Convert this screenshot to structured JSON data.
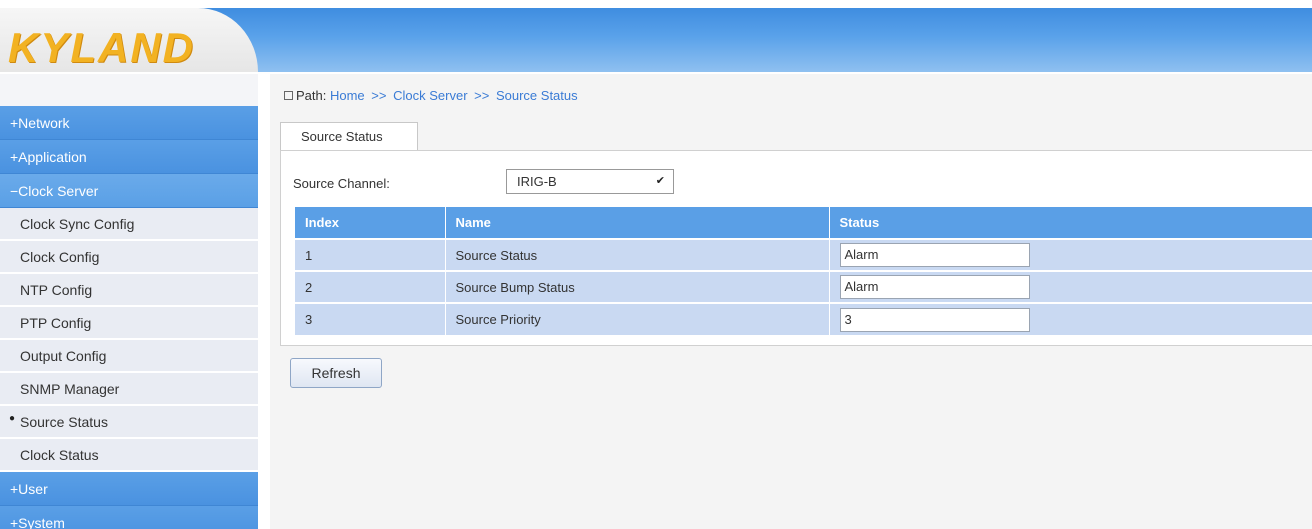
{
  "brand": {
    "logo_text": "KYLAND"
  },
  "sidebar": {
    "groups_top": [
      {
        "label": "+Network"
      },
      {
        "label": "+Application"
      },
      {
        "label": "−Clock Server"
      }
    ],
    "items": [
      {
        "label": "Clock Sync Config"
      },
      {
        "label": "Clock Config"
      },
      {
        "label": "NTP Config"
      },
      {
        "label": "PTP Config"
      },
      {
        "label": "Output Config"
      },
      {
        "label": "SNMP Manager"
      },
      {
        "label": "Source Status",
        "selected": true
      },
      {
        "label": "Clock Status"
      }
    ],
    "groups_bottom": [
      {
        "label": "+User"
      },
      {
        "label": "+System"
      }
    ]
  },
  "path": {
    "prefix": "Path:",
    "crumbs": [
      "Home",
      "Clock Server",
      "Source Status"
    ],
    "separator": ">>"
  },
  "tabs": [
    {
      "label": "Source Status"
    }
  ],
  "source_channel": {
    "label": "Source Channel:",
    "value": "IRIG-B"
  },
  "table": {
    "headers": [
      "Index",
      "Name",
      "Status"
    ],
    "rows": [
      {
        "index": "1",
        "name": "Source Status",
        "status": "Alarm"
      },
      {
        "index": "2",
        "name": "Source Bump Status",
        "status": "Alarm"
      },
      {
        "index": "3",
        "name": "Source Priority",
        "status": "3"
      }
    ]
  },
  "buttons": {
    "refresh": "Refresh"
  },
  "colors": {
    "nav_blue": "#4a92e0",
    "header_gradient_top": "#3f8de0",
    "logo_gold": "#f2b222",
    "row_bg": "#c9d9f2",
    "link_blue": "#3a7bd5"
  }
}
